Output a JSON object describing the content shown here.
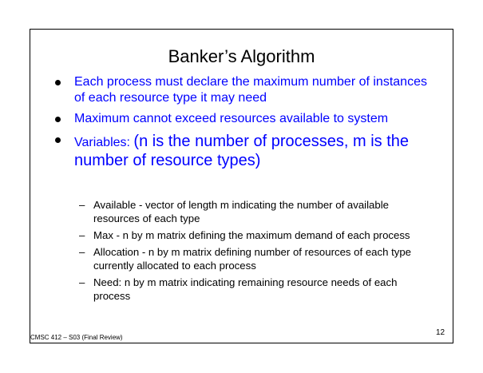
{
  "slide": {
    "title": "Banker’s Algorithm",
    "bullets": [
      {
        "text": "Each process must declare the maximum number of instances of each resource type it may need"
      },
      {
        "text": "Maximum cannot exceed resources available to system"
      },
      {
        "prefix": "Variables: ",
        "emphasis": "(n is the number of processes, m is the number of resource types)"
      }
    ],
    "sub_items": [
      {
        "dash": "–",
        "text": "Available  - vector of length m indicating the number of available resources of each type"
      },
      {
        "dash": "–",
        "text": "Max - n by m matrix defining the maximum demand of each process"
      },
      {
        "dash": "–",
        "text": "Allocation - n by m matrix defining number of resources of each type currently allocated to each process"
      },
      {
        "dash": "–",
        "text": "Need: n by m matrix indicating remaining resource needs of each process"
      }
    ],
    "footer_left": "CMSC 412 – S03  (Final Review)",
    "page_number": "12"
  },
  "colors": {
    "bullet_text": "#0000ff",
    "body_text": "#000000",
    "bullet_marker": "#000000"
  }
}
